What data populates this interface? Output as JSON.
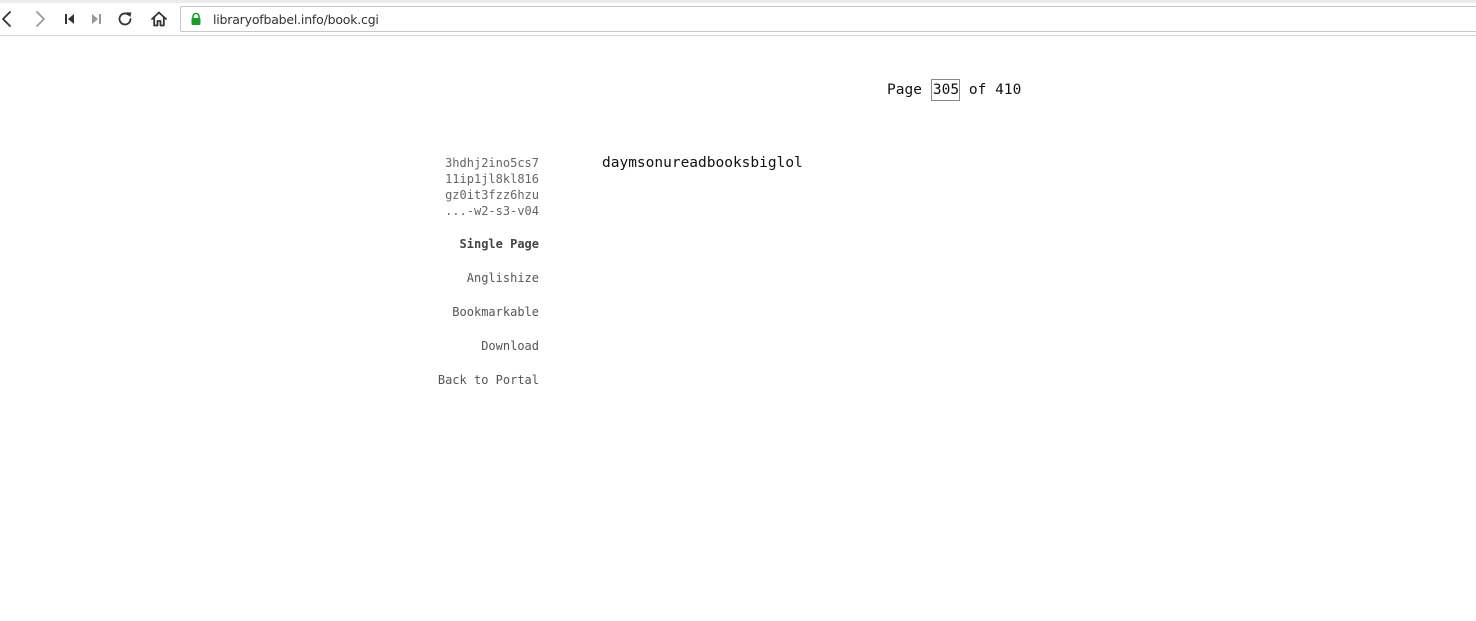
{
  "browser": {
    "url": "libraryofbabel.info/book.cgi",
    "buttons": {
      "back": "back-icon",
      "forward": "forward-icon",
      "first": "skip-first-icon",
      "last": "skip-last-icon",
      "reload": "reload-icon",
      "home": "home-icon"
    },
    "lock_color": "#1a9c2a"
  },
  "page_nav": {
    "prefix": "Page",
    "current": "305",
    "middle": "of",
    "total": "410"
  },
  "location": {
    "lines": [
      "3hdhj2ino5cs7",
      "11ip1jl8kl816",
      "gz0it3fzz6hzu",
      "...-w2-s3-v04"
    ]
  },
  "links": {
    "single_page": "Single Page",
    "anglishize": "Anglishize",
    "bookmarkable": "Bookmarkable",
    "download": "Download",
    "back_to_portal": "Back to Portal"
  },
  "book": {
    "text": "daymsonureadbooksbiglol"
  }
}
